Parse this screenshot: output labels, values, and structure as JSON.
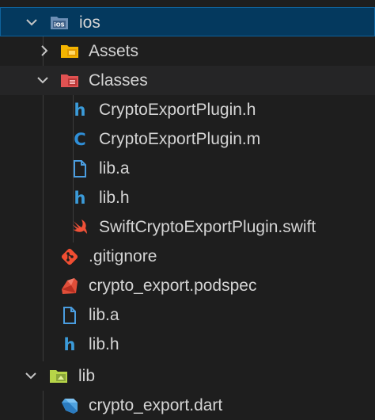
{
  "explorer": {
    "items": [
      {
        "label": "ios",
        "kind": "folder-ios",
        "expanded": true,
        "selected": true
      },
      {
        "label": "Assets",
        "kind": "folder-assets",
        "expanded": false
      },
      {
        "label": "Classes",
        "kind": "folder-classes",
        "expanded": true
      },
      {
        "label": "CryptoExportPlugin.h",
        "kind": "h-file",
        "glyph": "h"
      },
      {
        "label": "CryptoExportPlugin.m",
        "kind": "m-file",
        "glyph": "C"
      },
      {
        "label": "lib.a",
        "kind": "generic-file"
      },
      {
        "label": "lib.h",
        "kind": "h-file",
        "glyph": "h"
      },
      {
        "label": "SwiftCryptoExportPlugin.swift",
        "kind": "swift-file"
      },
      {
        "label": ".gitignore",
        "kind": "git-file"
      },
      {
        "label": "crypto_export.podspec",
        "kind": "ruby-file"
      },
      {
        "label": "lib.a",
        "kind": "generic-file"
      },
      {
        "label": "lib.h",
        "kind": "h-file",
        "glyph": "h"
      },
      {
        "label": "lib",
        "kind": "folder-lib",
        "expanded": true
      },
      {
        "label": "crypto_export.dart",
        "kind": "dart-file"
      }
    ]
  },
  "colors": {
    "background": "#1e1e1e",
    "selection": "#04395e",
    "selection_border": "#0e639c",
    "text": "#d4d4d4",
    "h_icon": "#3b9bd9",
    "swift_icon": "#f05138",
    "git_icon": "#f14e32",
    "folder_yellow": "#f4b400",
    "folder_red": "#e05252",
    "folder_lib": "#b7d548",
    "dart_icon": "#4fa3e0"
  }
}
